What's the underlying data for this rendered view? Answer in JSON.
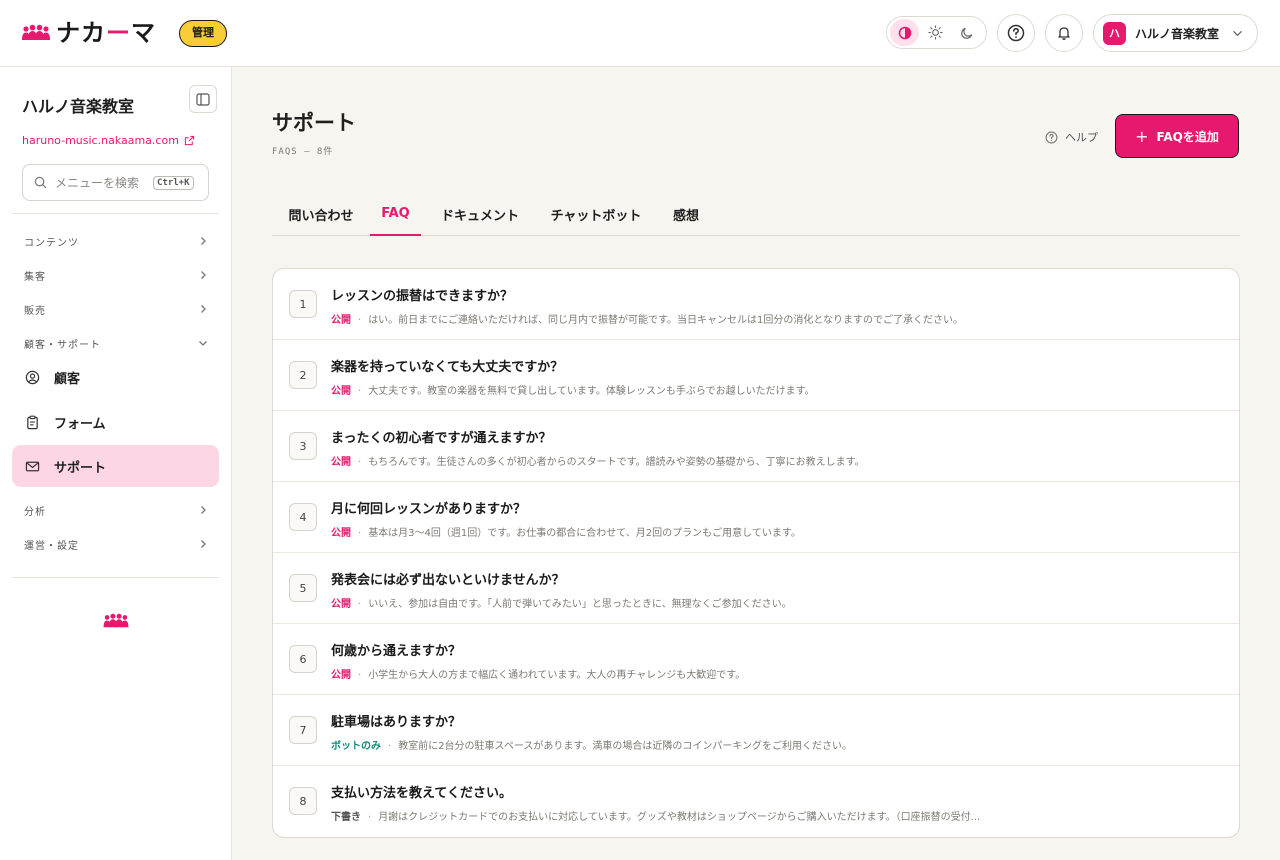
{
  "header": {
    "logo_text_a": "ナカ",
    "logo_text_dash": "ー",
    "logo_text_b": "マ",
    "admin_badge": "管理",
    "account_initial": "ハ",
    "account_name": "ハルノ音楽教室"
  },
  "sidebar": {
    "brand": "ハルノ音楽教室",
    "site_url": "haruno-music.nakaama.com",
    "search_placeholder": "メニューを検索",
    "search_shortcut": "Ctrl+K",
    "sections": [
      {
        "label": "コンテンツ"
      },
      {
        "label": "集客"
      },
      {
        "label": "販売"
      },
      {
        "label": "顧客・サポート"
      },
      {
        "label": "分析"
      },
      {
        "label": "運営・設定"
      }
    ],
    "items": [
      {
        "label": "顧客",
        "icon": "user-circle-icon"
      },
      {
        "label": "フォーム",
        "icon": "clipboard-icon"
      },
      {
        "label": "サポート",
        "icon": "mail-icon"
      }
    ]
  },
  "page": {
    "title": "サポート",
    "subtitle": "FAQS — 8件",
    "help_label": "ヘルプ",
    "add_button": "FAQを追加"
  },
  "tabs": [
    {
      "label": "問い合わせ"
    },
    {
      "label": "FAQ"
    },
    {
      "label": "ドキュメント"
    },
    {
      "label": "チャットボット"
    },
    {
      "label": "感想"
    }
  ],
  "faqs": [
    {
      "num": "1",
      "question": "レッスンの振替はできますか？",
      "status": "公開",
      "answer": "はい。前日までにご連絡いただければ、同じ月内で振替が可能です。当日キャンセルは1回分の消化となりますのでご了承ください。"
    },
    {
      "num": "2",
      "question": "楽器を持っていなくても大丈夫ですか？",
      "status": "公開",
      "answer": "大丈夫です。教室の楽器を無料で貸し出しています。体験レッスンも手ぶらでお越しいただけます。"
    },
    {
      "num": "3",
      "question": "まったくの初心者ですが通えますか？",
      "status": "公開",
      "answer": "もちろんです。生徒さんの多くが初心者からのスタートです。譜読みや姿勢の基礎から、丁寧にお教えします。"
    },
    {
      "num": "4",
      "question": "月に何回レッスンがありますか？",
      "status": "公開",
      "answer": "基本は月3〜4回（週1回）です。お仕事の都合に合わせて、月2回のプランもご用意しています。"
    },
    {
      "num": "5",
      "question": "発表会には必ず出ないといけませんか？",
      "status": "公開",
      "answer": "いいえ、参加は自由です。「人前で弾いてみたい」と思ったときに、無理なくご参加ください。"
    },
    {
      "num": "6",
      "question": "何歳から通えますか？",
      "status": "公開",
      "answer": "小学生から大人の方まで幅広く通われています。大人の再チャレンジも大歓迎です。"
    },
    {
      "num": "7",
      "question": "駐車場はありますか？",
      "status": "ボットのみ",
      "answer": "教室前に2台分の駐車スペースがあります。満車の場合は近隣のコインパーキングをご利用ください。"
    },
    {
      "num": "8",
      "question": "支払い方法を教えてください。",
      "status": "下書き",
      "answer": "月謝はクレジットカードでのお支払いに対応しています。グッズや教材はショップページからご購入いただけます。（口座振替の受付..."
    }
  ],
  "colors": {
    "accent": "#e6196f",
    "bot_status": "#0f8a7a",
    "badge_yellow": "#f7cc36",
    "active_nav_bg": "#fdd6e6",
    "main_bg": "#f7f5f0"
  }
}
